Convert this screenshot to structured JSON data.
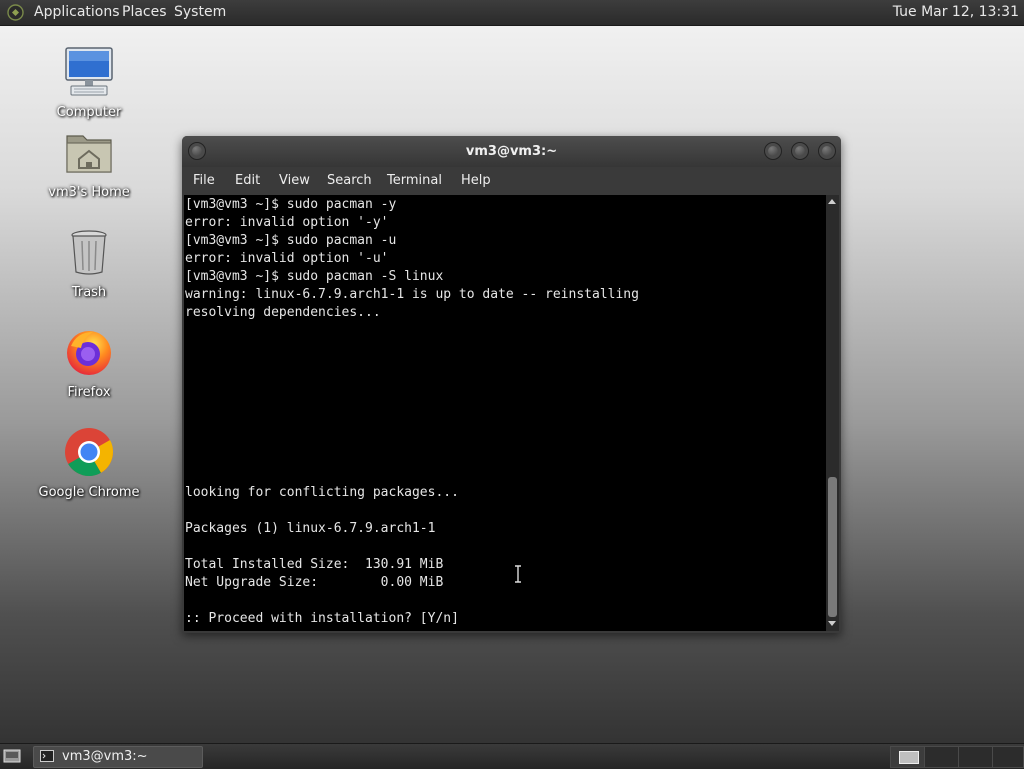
{
  "top_panel": {
    "menus": [
      "Applications",
      "Places",
      "System"
    ],
    "clock": "Tue Mar 12, 13:31"
  },
  "desktop_icons": [
    {
      "label": "Computer",
      "icon": "computer-icon"
    },
    {
      "label": "vm3's Home",
      "icon": "home-folder-icon"
    },
    {
      "label": "Trash",
      "icon": "trash-icon"
    },
    {
      "label": "Firefox",
      "icon": "firefox-icon"
    },
    {
      "label": "Google Chrome",
      "icon": "chrome-icon"
    }
  ],
  "terminal": {
    "title": "vm3@vm3:~",
    "menu": [
      "File",
      "Edit",
      "View",
      "Search",
      "Terminal",
      "Help"
    ],
    "lines": [
      "[vm3@vm3 ~]$ sudo pacman -y",
      "error: invalid option '-y'",
      "[vm3@vm3 ~]$ sudo pacman -u",
      "error: invalid option '-u'",
      "[vm3@vm3 ~]$ sudo pacman -S linux",
      "warning: linux-6.7.9.arch1-1 is up to date -- reinstalling",
      "resolving dependencies...",
      "",
      "",
      "",
      "",
      "",
      "",
      "",
      "",
      "looking for conflicting packages...",
      "",
      "Packages (1) linux-6.7.9.arch1-1",
      "",
      "Total Installed Size:  130.91 MiB",
      "Net Upgrade Size:        0.00 MiB",
      "",
      ":: Proceed with installation? [Y/n]"
    ]
  },
  "taskbar": {
    "task_label": "vm3@vm3:~",
    "workspaces": 4,
    "active_workspace": 1
  }
}
